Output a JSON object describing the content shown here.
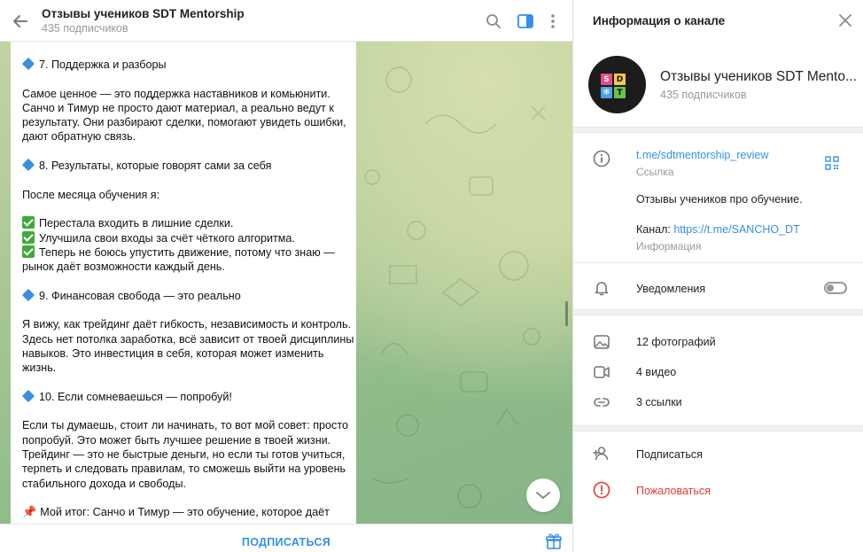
{
  "chat": {
    "title": "Отзывы учеников SDT Mentorship",
    "subscribers": "435 подписчиков",
    "message_lines": [
      {
        "type": "heading",
        "text": "7. Поддержка и разборы"
      },
      {
        "type": "blank"
      },
      {
        "type": "text",
        "text": "Самое ценное — это поддержка наставников и комьюнити."
      },
      {
        "type": "text",
        "text": "Санчо и Тимур не просто дают материал, а реально ведут к"
      },
      {
        "type": "text",
        "text": "результату. Они разбирают сделки, помогают увидеть ошибки,"
      },
      {
        "type": "text",
        "text": "дают обратную связь."
      },
      {
        "type": "blank"
      },
      {
        "type": "heading",
        "text": "8. Результаты, которые говорят сами за себя"
      },
      {
        "type": "blank"
      },
      {
        "type": "text",
        "text": "После месяца обучения я:"
      },
      {
        "type": "blank"
      },
      {
        "type": "check",
        "text": "Перестала входить в лишние сделки."
      },
      {
        "type": "check",
        "text": "Улучшила свои входы за счёт чёткого алгоритма."
      },
      {
        "type": "check",
        "text": "Теперь не боюсь упустить движение, потому что знаю —"
      },
      {
        "type": "text",
        "text": "рынок даёт возможности каждый день."
      },
      {
        "type": "blank"
      },
      {
        "type": "heading",
        "text": "9. Финансовая свобода — это реально"
      },
      {
        "type": "blank"
      },
      {
        "type": "text",
        "text": "Я вижу, как трейдинг даёт гибкость, независимость и контроль."
      },
      {
        "type": "text",
        "text": "Здесь нет потолка заработка, всё зависит от твоей дисциплины и"
      },
      {
        "type": "text",
        "text": "навыков. Это инвестиция в себя, которая может изменить"
      },
      {
        "type": "text",
        "text": "жизнь."
      },
      {
        "type": "blank"
      },
      {
        "type": "heading",
        "text": "10. Если сомневаешься — попробуй!"
      },
      {
        "type": "blank"
      },
      {
        "type": "text",
        "text": "Если ты думаешь, стоит ли начинать, то вот мой совет: просто"
      },
      {
        "type": "text",
        "text": "попробуй. Это может быть лучшее решение в твоей жизни."
      },
      {
        "type": "text",
        "text": "Трейдинг — это не быстрые деньги, но если ты готов учиться,"
      },
      {
        "type": "text",
        "text": "терпеть и следовать правилам, то сможешь выйти на уровень"
      },
      {
        "type": "text",
        "text": "стабильного дохода и свободы."
      },
      {
        "type": "blank"
      },
      {
        "type": "pin",
        "text": "Мой итог: Санчо и Тимур — это обучение, которое даёт"
      }
    ],
    "subscribe_label": "ПОДПИСАТЬСЯ",
    "icons": {
      "back": "arrow-left-icon",
      "search": "search-icon",
      "sidebar": "sidebar-toggle-icon",
      "menu": "more-vertical-icon",
      "scroll_down": "chevron-down-icon",
      "gift": "gift-icon"
    }
  },
  "panel": {
    "title": "Информация о канале",
    "channel_name": "Отзывы учеников SDT Mentorship",
    "channel_name_shown": "Отзывы учеников SDT Mentо...",
    "subscribers": "435 подписчиков",
    "avatar_letters": [
      "S",
      "D",
      "T"
    ],
    "link": "t.me/sdtmentorship_review",
    "link_caption": "Ссылка",
    "description": "Отзывы учеников про обучение.",
    "channel_prefix": "Канал: ",
    "channel_link": "https://t.me/SANCHO_DT",
    "info_caption": "Информация",
    "notifications_label": "Уведомления",
    "notifications_on": false,
    "media": [
      {
        "icon": "photo-icon",
        "label": "12 фотографий"
      },
      {
        "icon": "video-icon",
        "label": "4 видео"
      },
      {
        "icon": "link-icon",
        "label": "3 ссылки"
      }
    ],
    "subscribe_label": "Подписаться",
    "report_label": "Пожаловаться"
  },
  "colors": {
    "accent": "#3390ec",
    "danger": "#e53935",
    "check_green": "#3faa3a",
    "diamond_blue": "#3a8fe0"
  }
}
